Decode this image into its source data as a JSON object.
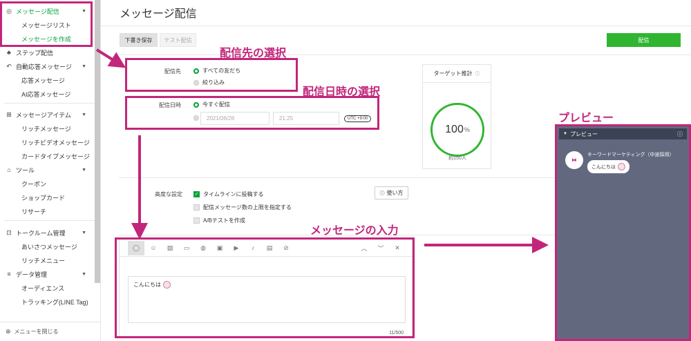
{
  "sidebar": {
    "items": [
      {
        "label": "メッセージ配信",
        "icon": "broadcast-icon",
        "chevron": true,
        "active": true
      },
      {
        "label": "メッセージリスト",
        "sub": true
      },
      {
        "label": "メッセージを作成",
        "sub": true,
        "active": true
      },
      {
        "label": "ステップ配信",
        "icon": "step-icon"
      },
      {
        "label": "自動応答メッセージ",
        "icon": "auto-reply-icon",
        "chevron": true
      },
      {
        "label": "応答メッセージ",
        "sub": true
      },
      {
        "label": "AI応答メッセージ",
        "sub": true
      },
      {
        "label": "メッセージアイテム",
        "icon": "message-item-icon",
        "chevron": true
      },
      {
        "label": "リッチメッセージ",
        "sub": true
      },
      {
        "label": "リッチビデオメッセージ",
        "sub": true
      },
      {
        "label": "カードタイプメッセージ",
        "sub": true
      },
      {
        "label": "ツール",
        "icon": "tools-icon",
        "chevron": true
      },
      {
        "label": "クーポン",
        "sub": true
      },
      {
        "label": "ショップカード",
        "sub": true
      },
      {
        "label": "リサーチ",
        "sub": true
      },
      {
        "label": "トークルーム管理",
        "icon": "talkroom-icon",
        "chevron": true
      },
      {
        "label": "あいさつメッセージ",
        "sub": true
      },
      {
        "label": "リッチメニュー",
        "sub": true
      },
      {
        "label": "データ管理",
        "icon": "database-icon",
        "chevron": true
      },
      {
        "label": "オーディエンス",
        "sub": true
      },
      {
        "label": "トラッキング(LINE Tag)",
        "sub": true
      }
    ],
    "footer_label": "メニューを閉じる"
  },
  "header": {
    "title": "メッセージ配信",
    "draft_label": "下書き保存",
    "test_label": "テスト配信",
    "send_label": "配信"
  },
  "recipient": {
    "label": "配信先",
    "options": [
      "すべての友だち",
      "絞り込み"
    ]
  },
  "schedule": {
    "label": "配信日時",
    "now_label": "今すぐ配信",
    "date_placeholder": "2021/06/28",
    "time_placeholder": "21:25",
    "timezone": "UTC +9:00"
  },
  "target": {
    "title": "ターゲット推計",
    "percent": "100",
    "unit": "%",
    "approx": "約150人"
  },
  "advanced": {
    "label": "高度な設定",
    "options": [
      {
        "label": "タイムラインに投稿する",
        "checked": true
      },
      {
        "label": "配信メッセージ数の上限を指定する",
        "checked": false
      },
      {
        "label": "A/Bテストを作成",
        "checked": false
      }
    ],
    "usage_label": "使い方"
  },
  "editor": {
    "text": "こんにちは",
    "counter": "11/500"
  },
  "preview": {
    "title": "プレビュー",
    "account_name": "キーワードマーケティング（中途採用）",
    "message": "こんにちは"
  },
  "annotations": {
    "recipient": "配信先の選択",
    "schedule": "配信日時の選択",
    "message": "メッセージの入力",
    "preview": "プレビュー"
  },
  "colors": {
    "line_green": "#06a33a",
    "send_button": "#2fb52f",
    "annotation": "#c2267a",
    "preview_bg": "#62697f"
  }
}
